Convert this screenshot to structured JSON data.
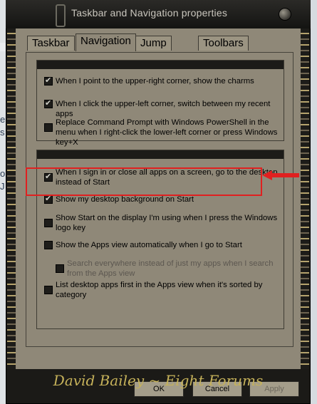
{
  "window": {
    "title": "Taskbar and Navigation properties"
  },
  "tabs": [
    {
      "label": "Taskbar",
      "active": false
    },
    {
      "label": "Navigation",
      "active": true
    },
    {
      "label": "Jump Lists",
      "active": false
    },
    {
      "label": "Toolbars",
      "active": false
    }
  ],
  "corner_navigation": {
    "items": [
      {
        "label": "When I point to the upper-right corner, show the charms",
        "checked": true
      },
      {
        "label": "When I click the upper-left corner, switch between my recent apps",
        "checked": true
      },
      {
        "label": "Replace Command Prompt with Windows PowerShell in the menu when I right-click the lower-left corner or press Windows key+X",
        "checked": false
      }
    ]
  },
  "start_screen": {
    "items": [
      {
        "label": "When I sign in or close all apps on a screen, go to the desktop instead of Start",
        "checked": true
      },
      {
        "label": "Show my desktop background on Start",
        "checked": true
      },
      {
        "label": "Show Start on the display I'm using when I press the Windows logo key",
        "checked": false
      },
      {
        "label": "Show the Apps view automatically when I go to Start",
        "checked": false
      },
      {
        "label": "Search everywhere instead of just my apps when I search from the Apps view",
        "checked": false,
        "disabled": true
      },
      {
        "label": "List desktop apps first in the Apps view when it's sorted by category",
        "checked": false
      }
    ]
  },
  "buttons": {
    "ok": "OK",
    "cancel": "Cancel",
    "apply": "Apply"
  },
  "signature": "David Bailey ~ Eight Forums",
  "background_text": [
    "e",
    "s",
    "o",
    "J"
  ],
  "colors": {
    "highlight": "#e02020",
    "signature": "#c6b25a"
  }
}
